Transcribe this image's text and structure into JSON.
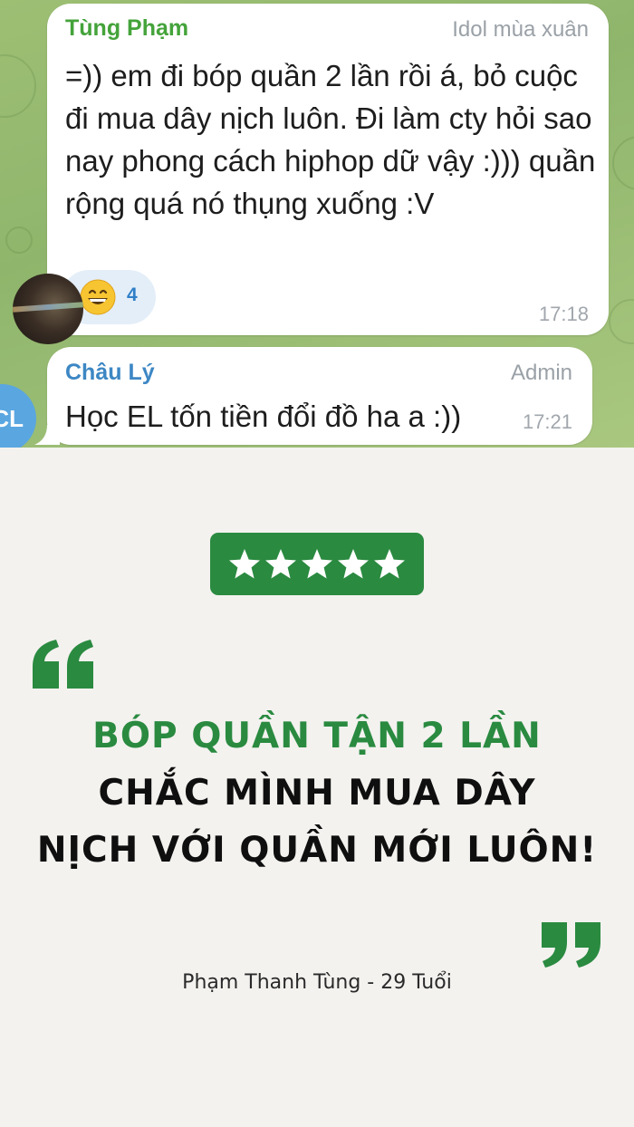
{
  "chat": {
    "messages": [
      {
        "sender": "Tùng Phạm",
        "tag": "Idol mùa xuân",
        "text": "=)) em đi bóp quần 2 lần rồi á, bỏ cuộc đi mua dây nịch luôn. Đi làm cty hỏi sao nay phong cách hiphop dữ vậy :))) quần rộng quá nó thụng xuống :V",
        "reaction": {
          "emoji": "grinning-face",
          "count": "4"
        },
        "time": "17:18"
      },
      {
        "sender": "Châu Lý",
        "tag": "Admin",
        "text": "Học EL tốn tiền đổi đồ ha a :))",
        "time": "17:21",
        "avatar_initials": "CL"
      }
    ]
  },
  "testimonial": {
    "rating": {
      "stars": 5,
      "out_of": 5
    },
    "headline_line_1": "BÓP QUẦN TẬN 2 LẦN",
    "headline_line_2": "CHẮC MÌNH MUA DÂY",
    "headline_line_3": "NỊCH VỚI QUẦN MỚI LUÔN!",
    "author": "Phạm Thanh Tùng - 29 Tuổi"
  },
  "colors": {
    "accent_green": "#2a8a40",
    "sender_green": "#44a33a",
    "sender_blue": "#3d87c4",
    "page_background": "#f3f2ef"
  }
}
